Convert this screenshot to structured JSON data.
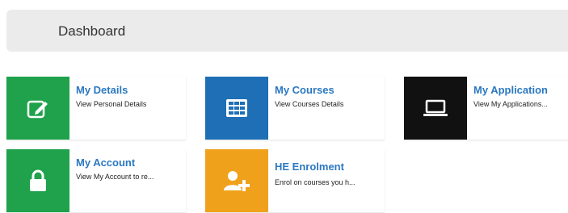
{
  "header": {
    "title": "Dashboard"
  },
  "tiles": [
    {
      "title": "My Details",
      "desc": "View Personal Details",
      "icon": "edit-icon",
      "color": "#1fa24b"
    },
    {
      "title": "My Courses",
      "desc": "View Courses Details",
      "icon": "table-icon",
      "color": "#1f6fb6"
    },
    {
      "title": "My Application",
      "desc": "View My Applications...",
      "icon": "laptop-icon",
      "color": "#111111"
    },
    {
      "title": "My Account",
      "desc": "View My Account to re...",
      "icon": "lock-icon",
      "color": "#1fa24b"
    },
    {
      "title": "HE Enrolment",
      "desc": "Enrol on courses you h...",
      "icon": "add-user-icon",
      "color": "#f0a11c"
    }
  ]
}
